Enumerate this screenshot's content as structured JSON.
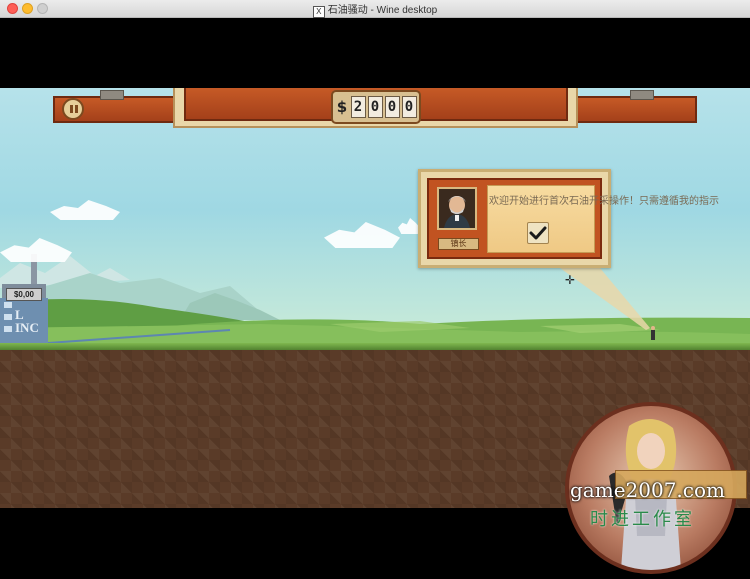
{
  "window": {
    "title": "石油骚动 - Wine desktop",
    "app_icon": "x11-icon",
    "app_icon_glyph": "X"
  },
  "hud": {
    "money_symbol": "$",
    "money_digits": [
      "2",
      "0",
      "0",
      "0"
    ],
    "pause_icon": "pause-icon"
  },
  "dialog": {
    "speaker_name": "镇长",
    "message": "欢迎开始进行首次石油开采操作！只需遵循我的指示",
    "confirm_icon": "checkmark-icon",
    "confirm_glyph": "✔"
  },
  "building": {
    "sign_value": "$0,00",
    "letters_line1": "L",
    "letters_line2": "INC"
  },
  "watermark": {
    "site": "game2007.com",
    "studio": "时进工作室"
  },
  "colors": {
    "wood": "#b34a1f",
    "wood_border": "#6f2a10",
    "sky": "#a7dbe5",
    "grass": "#6aa843",
    "dirt": "#5a3b28"
  }
}
